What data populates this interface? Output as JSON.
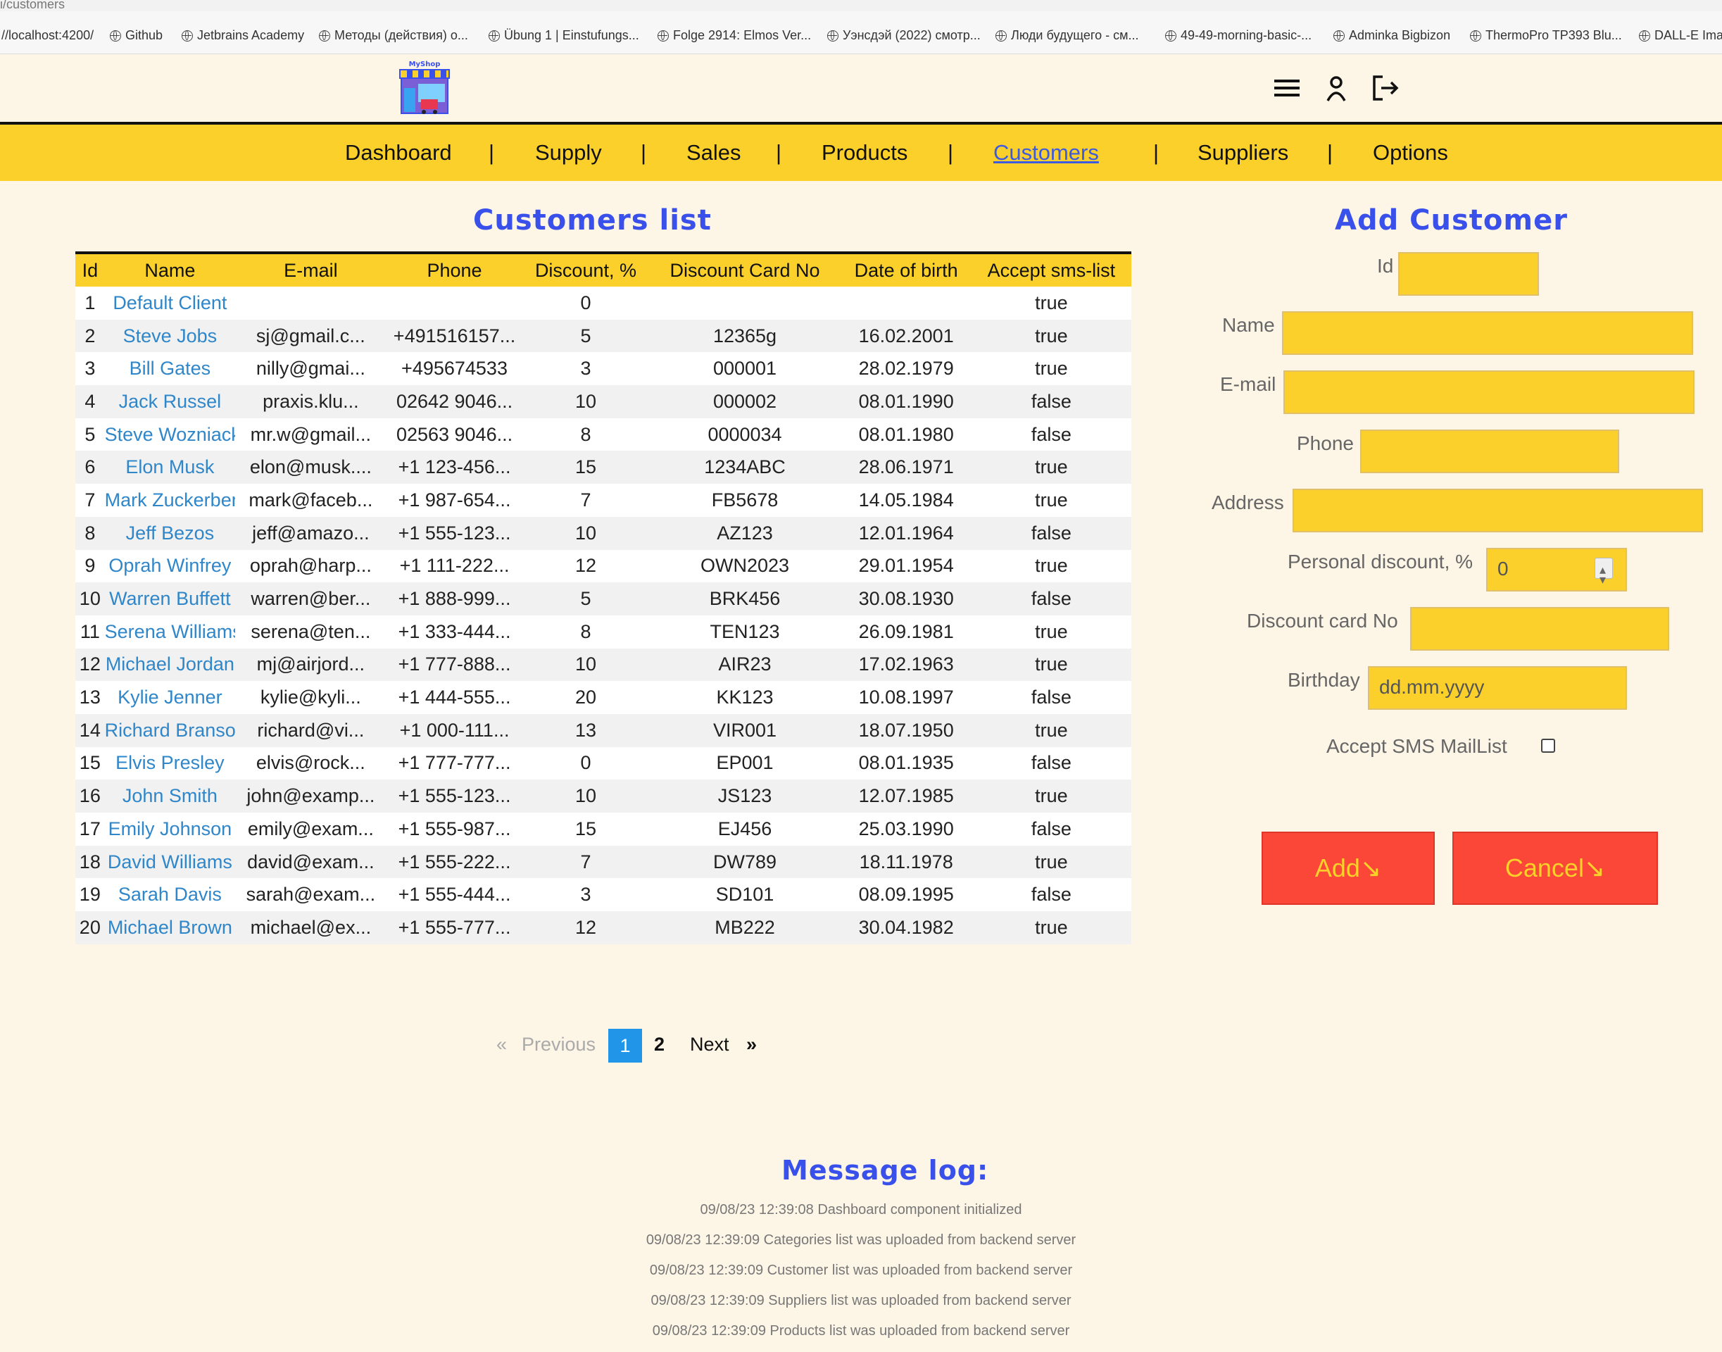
{
  "browser": {
    "url_fragment": "i/customers",
    "bookmarks": [
      {
        "label": "//localhost:4200/",
        "icon": "none"
      },
      {
        "label": "Github",
        "icon": "globe-icon"
      },
      {
        "label": "Jetbrains Academy",
        "icon": "globe-icon"
      },
      {
        "label": "Методы (действия) o...",
        "icon": "globe-icon"
      },
      {
        "label": "Übung 1 | Einstufungs...",
        "icon": "globe-icon"
      },
      {
        "label": "Folge 2914: Elmos Ver...",
        "icon": "globe-icon"
      },
      {
        "label": "Уэнсдэй (2022) смотр...",
        "icon": "globe-icon"
      },
      {
        "label": "Люди будущего - см...",
        "icon": "globe-icon"
      },
      {
        "label": "49-49-morning-basic-...",
        "icon": "globe-icon"
      },
      {
        "label": "Adminka Bigbizon",
        "icon": "globe-icon"
      },
      {
        "label": "ThermoPro TP393 Blu...",
        "icon": "globe-icon"
      },
      {
        "label": "DALL-E Ima",
        "icon": "globe-icon"
      }
    ]
  },
  "header": {
    "logo_text": "MyShop",
    "icons": [
      "menu-icon",
      "user-icon",
      "logout-icon"
    ]
  },
  "nav": {
    "items": [
      {
        "label": "Dashboard",
        "active": false
      },
      {
        "label": "Supply",
        "active": false
      },
      {
        "label": "Sales",
        "active": false
      },
      {
        "label": "Products",
        "active": false
      },
      {
        "label": "Customers",
        "active": true
      },
      {
        "label": "Suppliers",
        "active": false
      },
      {
        "label": "Options",
        "active": false
      }
    ],
    "separator": "|"
  },
  "customers": {
    "title": "Customers list",
    "columns": [
      "Id",
      "Name",
      "E-mail",
      "Phone",
      "Discount, %",
      "Discount Card No",
      "Date of birth",
      "Accept sms-list"
    ],
    "rows": [
      [
        "1",
        "Default Client",
        "",
        "",
        "0",
        "",
        "",
        "true"
      ],
      [
        "2",
        "Steve Jobs",
        "sj@gmail.c...",
        "+491516157...",
        "5",
        "12365g",
        "16.02.2001",
        "true"
      ],
      [
        "3",
        "Bill Gates",
        "nilly@gmai...",
        "+495674533",
        "3",
        "000001",
        "28.02.1979",
        "true"
      ],
      [
        "4",
        "Jack Russel",
        "praxis.klu...",
        "02642 9046...",
        "10",
        "000002",
        "08.01.1990",
        "false"
      ],
      [
        "5",
        "Steve Wozniack",
        "mr.w@gmail...",
        "02563 9046...",
        "8",
        "0000034",
        "08.01.1980",
        "false"
      ],
      [
        "6",
        "Elon Musk",
        "elon@musk....",
        "+1 123-456...",
        "15",
        "1234ABC",
        "28.06.1971",
        "true"
      ],
      [
        "7",
        "Mark Zuckerberg",
        "mark@faceb...",
        "+1 987-654...",
        "7",
        "FB5678",
        "14.05.1984",
        "true"
      ],
      [
        "8",
        "Jeff Bezos",
        "jeff@amazo...",
        "+1 555-123...",
        "10",
        "AZ123",
        "12.01.1964",
        "false"
      ],
      [
        "9",
        "Oprah Winfrey",
        "oprah@harp...",
        "+1 111-222...",
        "12",
        "OWN2023",
        "29.01.1954",
        "true"
      ],
      [
        "10",
        "Warren Buffett",
        "warren@ber...",
        "+1 888-999...",
        "5",
        "BRK456",
        "30.08.1930",
        "false"
      ],
      [
        "11",
        "Serena Williams",
        "serena@ten...",
        "+1 333-444...",
        "8",
        "TEN123",
        "26.09.1981",
        "true"
      ],
      [
        "12",
        "Michael Jordan",
        "mj@airjord...",
        "+1 777-888...",
        "10",
        "AIR23",
        "17.02.1963",
        "true"
      ],
      [
        "13",
        "Kylie Jenner",
        "kylie@kyli...",
        "+1 444-555...",
        "20",
        "KK123",
        "10.08.1997",
        "false"
      ],
      [
        "14",
        "Richard Branson",
        "richard@vi...",
        "+1 000-111...",
        "13",
        "VIR001",
        "18.07.1950",
        "true"
      ],
      [
        "15",
        "Elvis Presley",
        "elvis@rock...",
        "+1 777-777...",
        "0",
        "EP001",
        "08.01.1935",
        "false"
      ],
      [
        "16",
        "John Smith",
        "john@examp...",
        "+1 555-123...",
        "10",
        "JS123",
        "12.07.1985",
        "true"
      ],
      [
        "17",
        "Emily Johnson",
        "emily@exam...",
        "+1 555-987...",
        "15",
        "EJ456",
        "25.03.1990",
        "false"
      ],
      [
        "18",
        "David Williams",
        "david@exam...",
        "+1 555-222...",
        "7",
        "DW789",
        "18.11.1978",
        "true"
      ],
      [
        "19",
        "Sarah Davis",
        "sarah@exam...",
        "+1 555-444...",
        "3",
        "SD101",
        "08.09.1995",
        "false"
      ],
      [
        "20",
        "Michael Brown",
        "michael@ex...",
        "+1 555-777...",
        "12",
        "MB222",
        "30.04.1982",
        "true"
      ]
    ]
  },
  "pagination": {
    "prev_arrow": "«",
    "prev_label": "Previous",
    "pages": [
      "1",
      "2"
    ],
    "current": "1",
    "next_label": "Next",
    "next_arrow": "»"
  },
  "add_form": {
    "title": "Add Customer",
    "id_label": "Id",
    "name_label": "Name",
    "email_label": "E-mail",
    "phone_label": "Phone",
    "address_label": "Address",
    "discount_label": "Personal discount, %",
    "discount_value": "0",
    "card_label": "Discount card No",
    "birthday_label": "Birthday",
    "birthday_placeholder": "dd.mm.yyyy",
    "sms_label": "Accept SMS MailList",
    "sms_checked": false,
    "add_button": "Add↘",
    "cancel_button": "Cancel↘"
  },
  "message_log": {
    "title": "Message log:",
    "lines": [
      "09/08/23 12:39:08 Dashboard component initialized",
      "09/08/23 12:39:09 Categories list was uploaded from backend server",
      "09/08/23 12:39:09 Customer list was uploaded from backend server",
      "09/08/23 12:39:09 Suppliers list was uploaded from backend server",
      "09/08/23 12:39:09 Products list was uploaded from backend server"
    ]
  },
  "colors": {
    "background": "#fdf5e6",
    "accent_yellow": "#fbd02b",
    "title_blue": "#3a50ea",
    "link_blue": "#2f86c9",
    "button_red": "#fa4738"
  }
}
